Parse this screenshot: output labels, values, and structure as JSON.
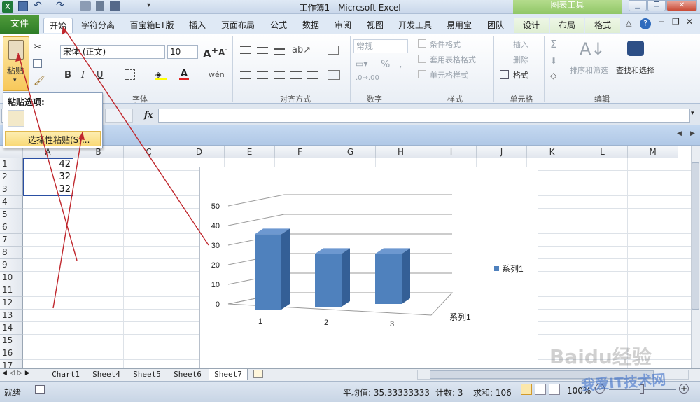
{
  "app": {
    "title": "工作簿1 - Micrcsoft Excel",
    "context_group": "图表工具"
  },
  "quick_access": {
    "save_icon": "save-icon",
    "undo_icon": "undo-icon",
    "redo_icon": "redo-icon"
  },
  "window_buttons": {
    "minimize": "▁",
    "restore": "❐",
    "close": "✕"
  },
  "tabs": [
    {
      "label": "文件"
    },
    {
      "label": "开始"
    },
    {
      "label": "字符分离"
    },
    {
      "label": "百宝箱ET版"
    },
    {
      "label": "插入"
    },
    {
      "label": "页面布局"
    },
    {
      "label": "公式"
    },
    {
      "label": "数据"
    },
    {
      "label": "审阅"
    },
    {
      "label": "视图"
    },
    {
      "label": "开发工具"
    },
    {
      "label": "易用宝"
    },
    {
      "label": "团队"
    },
    {
      "label": "设计"
    },
    {
      "label": "布局"
    },
    {
      "label": "格式"
    }
  ],
  "ribbon": {
    "paste_label": "粘贴",
    "font_name": "宋体 (正文)",
    "font_size": "10",
    "bold": "B",
    "italic": "I",
    "underline": "U",
    "number_format": "常规",
    "percent": "%",
    "cond_format": "条件格式",
    "table_format": "套用表格格式",
    "cell_style": "单元格样式",
    "insert": "插入",
    "delete": "删除",
    "format": "格式",
    "sum_icon": "Σ",
    "sort_filter": "排序和筛选",
    "find_select": "查找和选择",
    "groups": {
      "font": "字体",
      "align": "对齐方式",
      "number": "数字",
      "styles": "样式",
      "cells": "单元格",
      "edit": "编辑"
    }
  },
  "paste_menu": {
    "title": "粘贴选项:",
    "special": "选择性粘贴(S)..."
  },
  "formula_bar": {
    "fx": "fx",
    "value": ""
  },
  "grid": {
    "columns": [
      "A",
      "B",
      "C",
      "D",
      "E",
      "F",
      "G",
      "H",
      "I",
      "J",
      "K",
      "L",
      "M"
    ],
    "rows": [
      "1",
      "2",
      "3",
      "4",
      "5",
      "6",
      "7",
      "8",
      "9",
      "10",
      "11",
      "12",
      "13",
      "14",
      "15",
      "16",
      "17"
    ],
    "cells": [
      {
        "label": "42"
      },
      {
        "label": "32"
      },
      {
        "label": "32"
      }
    ]
  },
  "chart_data": {
    "type": "bar",
    "categories": [
      "1",
      "2",
      "3"
    ],
    "series": [
      {
        "name": "系列1",
        "values": [
          42,
          32,
          32
        ]
      }
    ],
    "ylim": [
      0,
      50
    ],
    "yticks": [
      "0",
      "10",
      "20",
      "30",
      "40",
      "50"
    ],
    "legend": "系列1",
    "depth_label": "系列1",
    "legend_position": "right",
    "grid": true,
    "bar_color": "#4f81bd"
  },
  "sheets": [
    "Chart1",
    "Sheet4",
    "Sheet5",
    "Sheet6",
    "Sheet7"
  ],
  "active_sheet": "Sheet7",
  "status": {
    "mode": "就绪",
    "average": "平均值: 35.33333333",
    "count": "计数: 3",
    "sum": "求和: 106",
    "zoom": "100%"
  },
  "watermark": {
    "text": "Baidu经验",
    "site": "我爱IT技术网"
  }
}
